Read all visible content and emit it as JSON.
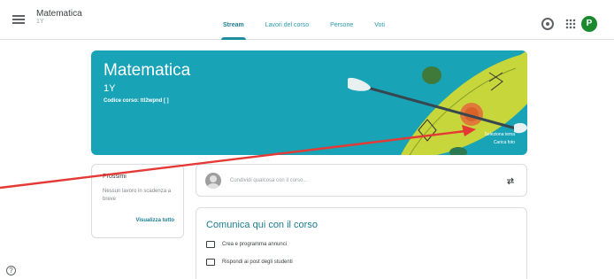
{
  "header": {
    "class_name": "Matematica",
    "section": "1Y",
    "tabs": [
      {
        "label": "Stream"
      },
      {
        "label": "Lavori del corso"
      },
      {
        "label": "Persone"
      },
      {
        "label": "Voti"
      }
    ],
    "avatar_letter": "P"
  },
  "banner": {
    "title": "Matematica",
    "subtitle": "1Y",
    "class_code": "Codice corso: ttl2wpnd [ ]",
    "select_theme": "Seleziona tema",
    "upload_photo": "Carica foto"
  },
  "upcoming": {
    "title": "Prossimi",
    "text": "Nessun lavoro in scadenza a breve",
    "view_all": "Visualizza tutto"
  },
  "announce": {
    "placeholder": "Condividi qualcosa con il corso..."
  },
  "communicate": {
    "title": "Comunica qui con il corso",
    "item1": "Crea e programma annunci",
    "item2": "Rispondi ai post degli studenti"
  },
  "colors": {
    "banner": "#19a3b6",
    "accent": "#1c7d8f",
    "arrow": "#e53935"
  }
}
